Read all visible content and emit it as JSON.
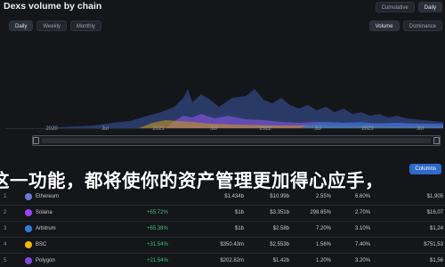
{
  "header": {
    "title": "Dexs volume by chain"
  },
  "left_tabs": [
    {
      "label": "Daily"
    },
    {
      "label": "Weekly"
    },
    {
      "label": "Monthly"
    }
  ],
  "right_tabs_top": [
    {
      "label": "Cumulative"
    },
    {
      "label": "Daily"
    }
  ],
  "right_tabs": [
    {
      "label": "Volume"
    },
    {
      "label": "Dominance"
    }
  ],
  "chart": {
    "x_ticks": [
      "2020",
      "Jul",
      "2021",
      "Jul",
      "2022",
      "Jul",
      "2023",
      "Jul"
    ]
  },
  "overlay_text": "这一功能，都将使你的资产管理更加得心应手，",
  "columns_button": {
    "label": "Columns"
  },
  "rows": [
    {
      "num": "1",
      "name": "Ethereum",
      "change": "+",
      "c1": "$1.434b",
      "c2": "$10.99b",
      "c3": "2.55%",
      "c4": "6.60%",
      "c5": "$1,905",
      "color": "#6b7ad8"
    },
    {
      "num": "2",
      "name": "Solana",
      "change": "+65.72%",
      "c1": "$1b",
      "c2": "$3.351b",
      "c3": "298.65%",
      "c4": "2.70%",
      "c5": "$16,07",
      "color": "#9945ff"
    },
    {
      "num": "3",
      "name": "Arbitrum",
      "change": "+65.38%",
      "c1": "$1b",
      "c2": "$2.58b",
      "c3": "7.20%",
      "c4": "3.10%",
      "c5": "$1,24",
      "color": "#2d7fd8"
    },
    {
      "num": "4",
      "name": "BSC",
      "change": "+31.54%",
      "c1": "$350.43m",
      "c2": "$2.553b",
      "c3": "1.56%",
      "c4": "7.40%",
      "c5": "$751,53",
      "color": "#f0b90b"
    },
    {
      "num": "5",
      "name": "Polygon",
      "change": "+21.54%",
      "c1": "$202.82m",
      "c2": "$1.42b",
      "c3": "1.20%",
      "c4": "3.20%",
      "c5": "$1,56",
      "color": "#8247e5"
    }
  ]
}
